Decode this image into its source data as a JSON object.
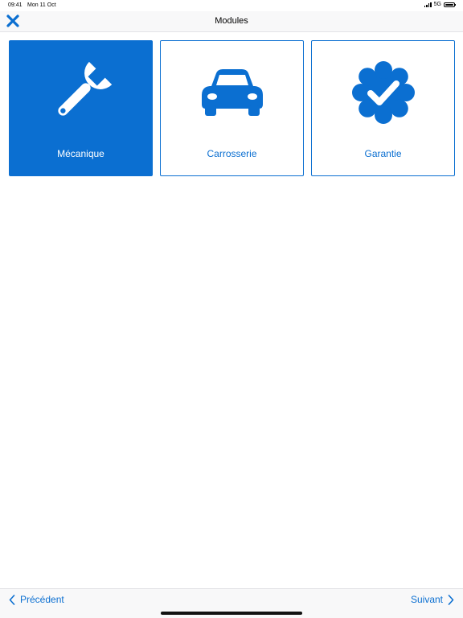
{
  "status_bar": {
    "time": "09:41",
    "date": "Mon 11 Oct",
    "network": "5G"
  },
  "nav": {
    "title": "Modules",
    "close_icon": "close-icon"
  },
  "modules": [
    {
      "label": "Mécanique",
      "icon": "wrench-icon",
      "selected": true
    },
    {
      "label": "Carrosserie",
      "icon": "car-icon",
      "selected": false
    },
    {
      "label": "Garantie",
      "icon": "verified-badge-icon",
      "selected": false
    }
  ],
  "footer": {
    "prev_label": "Précédent",
    "next_label": "Suivant"
  },
  "colors": {
    "accent": "#0b6fd1",
    "bar_background": "#f8f8f9"
  }
}
